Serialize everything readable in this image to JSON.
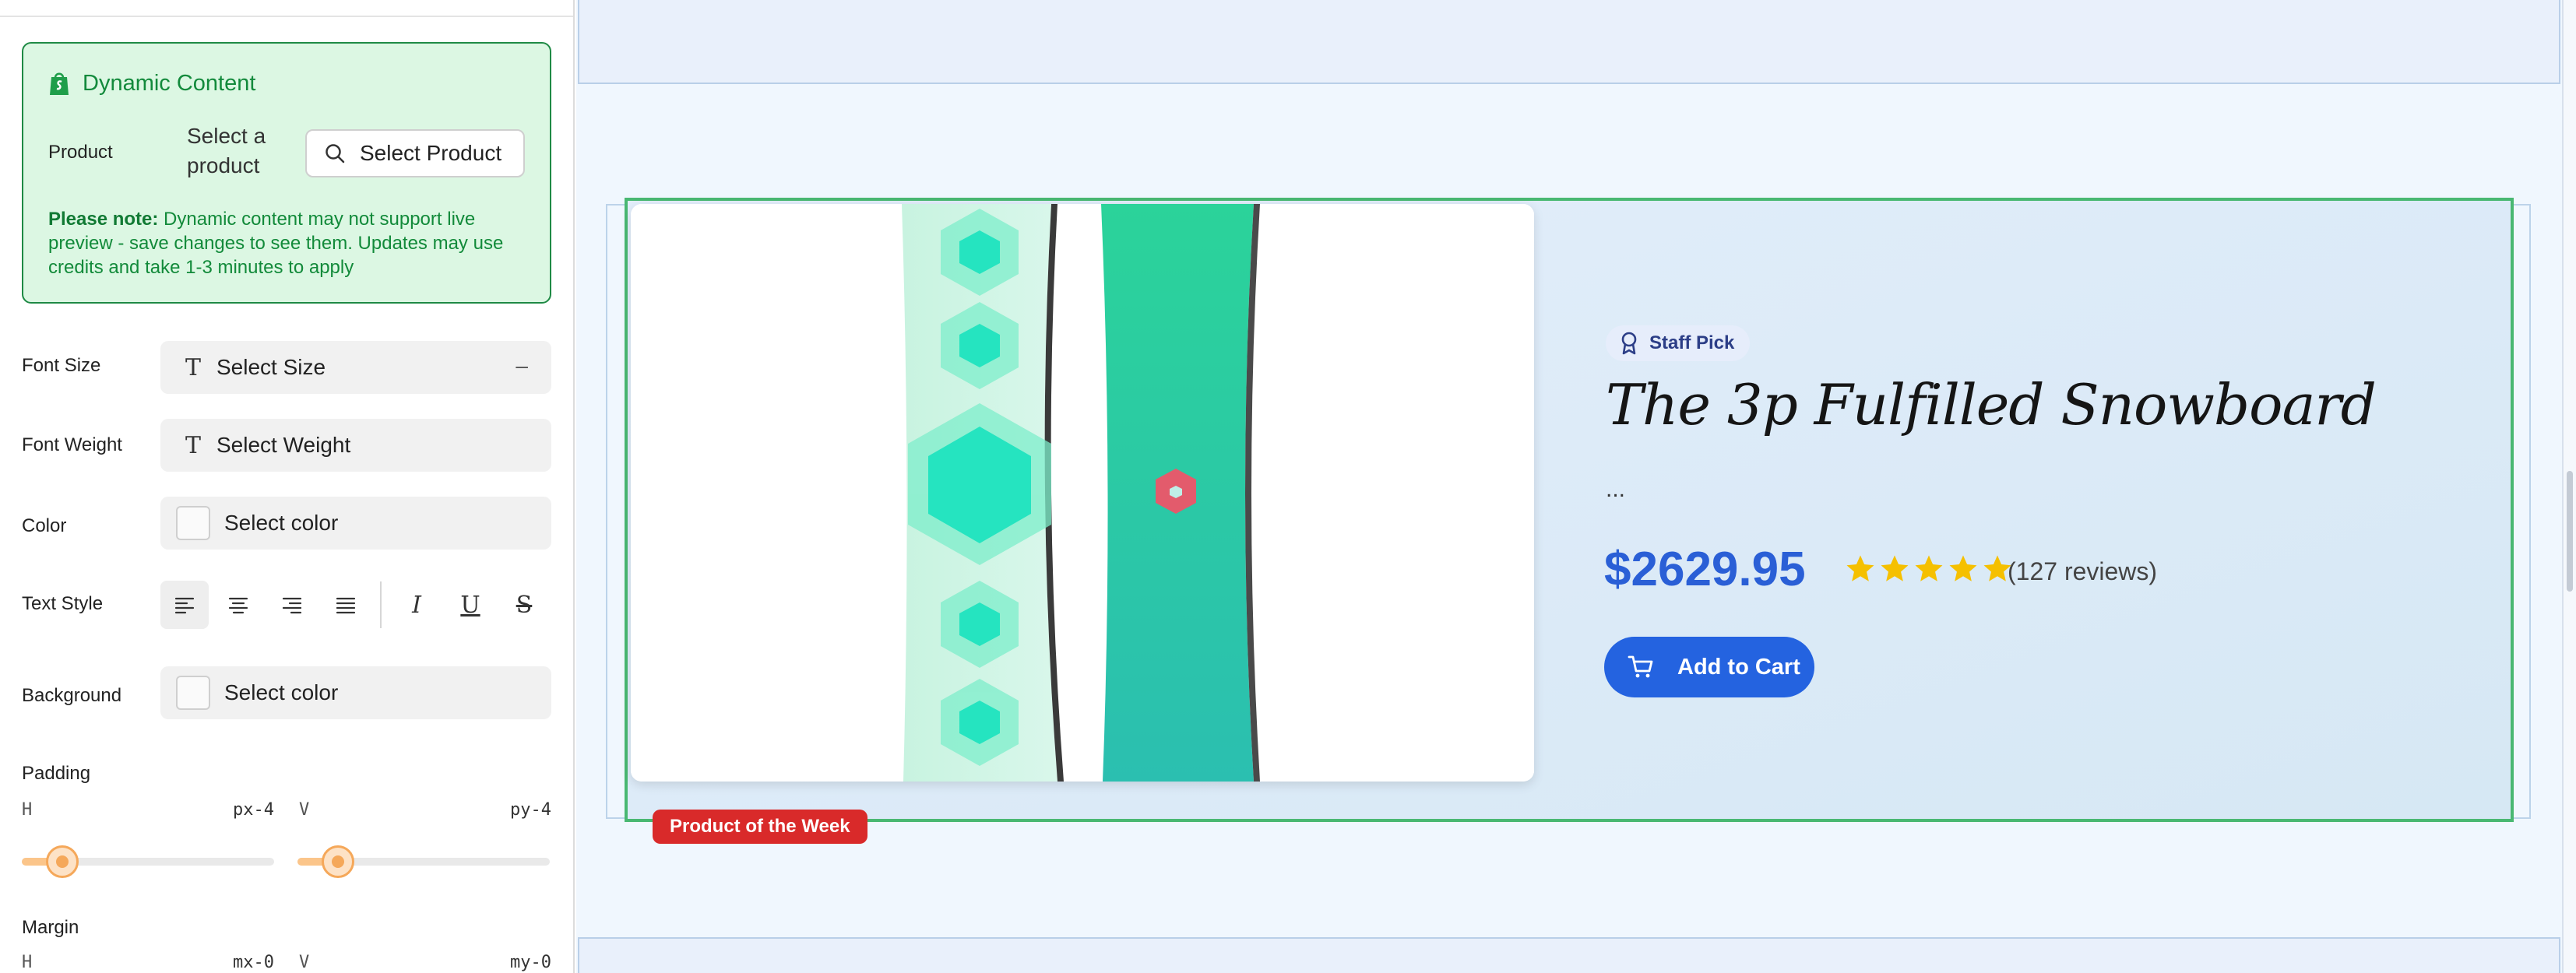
{
  "panel": {
    "dynamic_content": {
      "title": "Dynamic Content",
      "product_label": "Product",
      "product_value": "Select a product",
      "select_button": "Select Product",
      "note_bold": "Please note:",
      "note_text": " Dynamic content may not support live preview - save changes to see them. Updates may use credits and take 1-3 minutes to apply"
    },
    "font_size": {
      "label": "Font Size",
      "placeholder": "Select Size",
      "clear": "–"
    },
    "font_weight": {
      "label": "Font Weight",
      "placeholder": "Select Weight"
    },
    "color": {
      "label": "Color",
      "placeholder": "Select color"
    },
    "text_style": {
      "label": "Text Style",
      "italic_glyph": "I",
      "underline_glyph": "U",
      "strike_glyph": "S"
    },
    "background": {
      "label": "Background",
      "placeholder": "Select color"
    },
    "padding": {
      "label": "Padding",
      "h_label": "H",
      "h_value": "px-4",
      "v_label": "V",
      "v_value": "py-4",
      "h_level": 0.16,
      "v_level": 0.16
    },
    "margin": {
      "label": "Margin",
      "h_label": "H",
      "h_value": "mx-0",
      "v_label": "V",
      "v_value": "my-0"
    }
  },
  "product": {
    "badge": "Staff Pick",
    "title": "The 3p Fulfilled Snowboard",
    "description": "...",
    "price": "$2629.95",
    "rating": 5,
    "reviews": "(127 reviews)",
    "cta": "Add to Cart",
    "ribbon": "Product of the Week"
  },
  "colors": {
    "accent_green": "#138a3c",
    "price_blue": "#2a5fd6",
    "cta_blue": "#2463e0",
    "ribbon_red": "#d92a2a",
    "star_yellow": "#f5c000",
    "slider_orange": "#f5a85a"
  }
}
